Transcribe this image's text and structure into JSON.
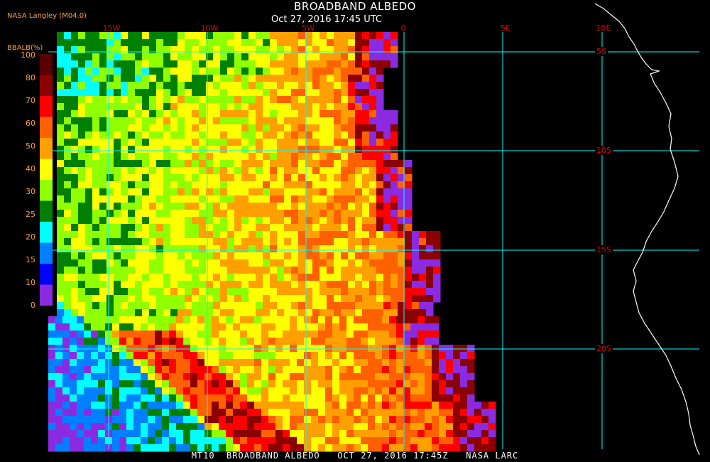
{
  "header": {
    "title": "BROADBAND ALBEDO",
    "subtitle": "Oct 27, 2016 17:45 UTC",
    "producer": "NASA Langley (M04.0)"
  },
  "colorbar": {
    "label": "BBALB(%)",
    "ticks": [
      "100",
      "80",
      "70",
      "60",
      "50",
      "40",
      "30",
      "25",
      "20",
      "15",
      "10",
      "0"
    ],
    "colors": [
      "#5a0000",
      "#8b0000",
      "#ff0000",
      "#ff6000",
      "#ffa000",
      "#ffff00",
      "#90ff00",
      "#008000",
      "#00ffff",
      "#0080ff",
      "#0000ff",
      "#8a2be2"
    ]
  },
  "grid": {
    "color": "#00ffff",
    "lon_labels": [
      "15W",
      "10W",
      "5W",
      "0",
      "5E",
      "10E"
    ],
    "lat_labels": [
      "5S",
      "10S",
      "15S",
      "20S"
    ]
  },
  "footer": {
    "text": "MT10  BROADBAND ALBEDO   OCT 27, 2016 17:45Z   NASA LARC"
  },
  "colors": {
    "label_orange": "#ffa030",
    "grid_label_red": "#dd0000",
    "coastline": "#ffffff",
    "background": "#000000"
  }
}
